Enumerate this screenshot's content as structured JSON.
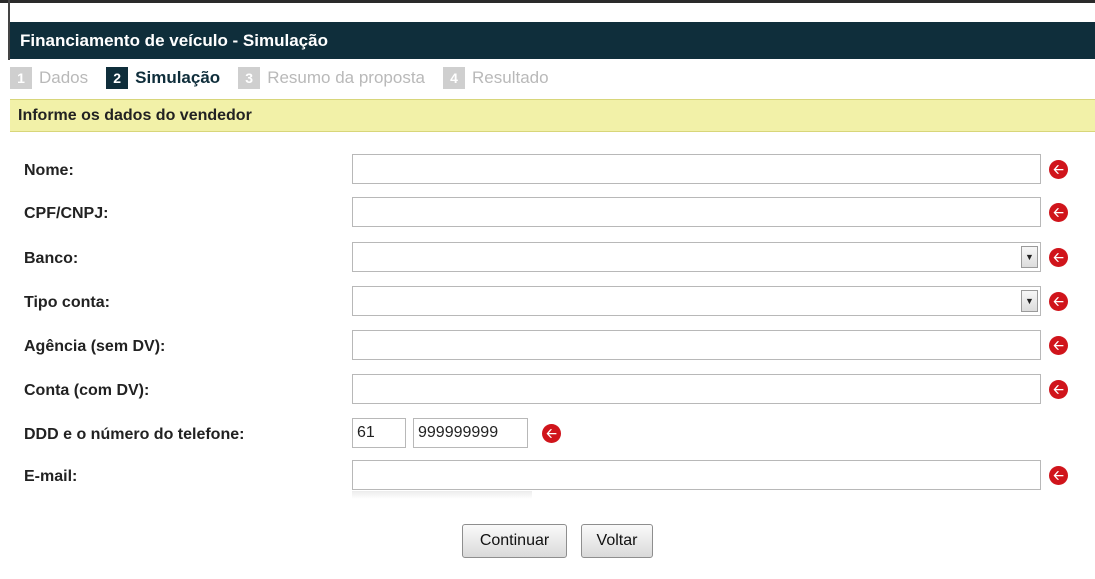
{
  "header": {
    "title": "Financiamento de veículo - Simulação"
  },
  "steps": [
    {
      "num": "1",
      "label": "Dados",
      "state": "inactive"
    },
    {
      "num": "2",
      "label": "Simulação",
      "state": "active"
    },
    {
      "num": "3",
      "label": "Resumo da proposta",
      "state": "inactive"
    },
    {
      "num": "4",
      "label": "Resultado",
      "state": "inactive"
    }
  ],
  "section": {
    "title": "Informe os dados do vendedor"
  },
  "form": {
    "nome": {
      "label": "Nome:",
      "value": ""
    },
    "cpf": {
      "label": "CPF/CNPJ:",
      "value": ""
    },
    "banco": {
      "label": "Banco:",
      "value": ""
    },
    "tipo_conta": {
      "label": "Tipo conta:",
      "value": ""
    },
    "agencia": {
      "label": "Agência (sem DV):",
      "value": ""
    },
    "conta": {
      "label": "Conta (com DV):",
      "value": ""
    },
    "telefone": {
      "label": "DDD e o número do telefone:",
      "ddd": "61",
      "numero": "999999999"
    },
    "email": {
      "label": "E-mail:",
      "value": ""
    }
  },
  "buttons": {
    "continuar": "Continuar",
    "voltar": "Voltar"
  },
  "icons": {
    "required": "arrow-left-circle-icon",
    "dropdown": "triangle-down-icon"
  },
  "colors": {
    "header_bg": "#0f2e3b",
    "section_bg": "#f2f1a8",
    "required_icon": "#d0141b"
  }
}
